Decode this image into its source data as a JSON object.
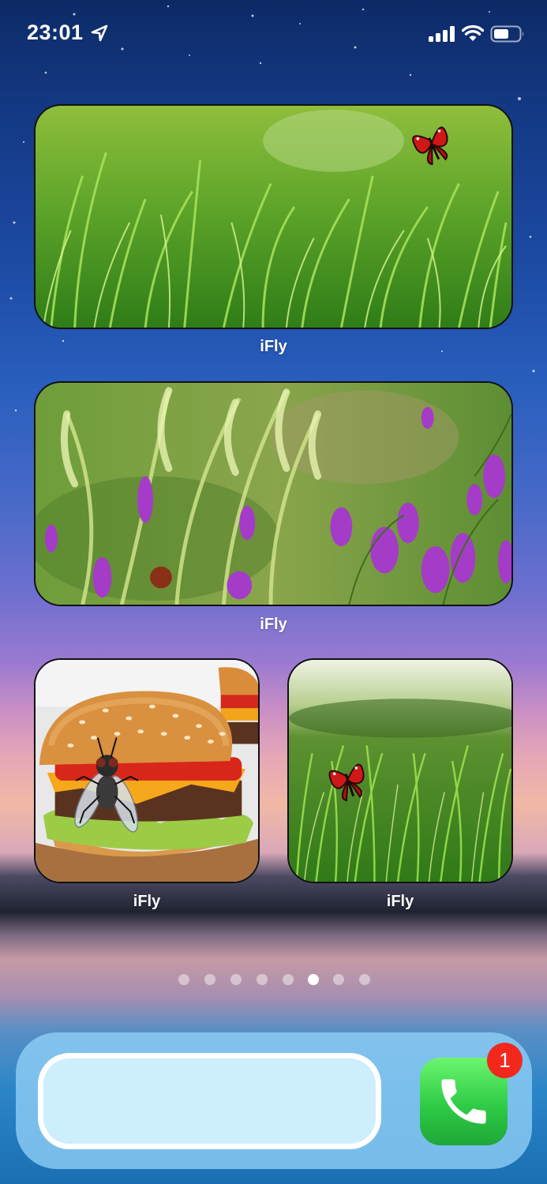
{
  "status_bar": {
    "time": "23:01",
    "icons": [
      "location-arrow-icon",
      "cellular-signal-icon",
      "wifi-icon",
      "battery-icon"
    ]
  },
  "widgets": [
    {
      "label": "iFly",
      "image": "grass field with red butterfly"
    },
    {
      "label": "iFly",
      "image": "wheat grass and purple wildflowers"
    },
    {
      "label": "iFly",
      "image": "hamburger with a fly"
    },
    {
      "label": "iFly",
      "image": "grass with red butterfly"
    }
  ],
  "page_indicator": {
    "count": 8,
    "active_index": 5
  },
  "dock": {
    "phone_app": {
      "icon": "phone-icon",
      "badge": "1"
    }
  },
  "colors": {
    "badge": "#f3281d",
    "phone_green": "#2fcb46"
  }
}
